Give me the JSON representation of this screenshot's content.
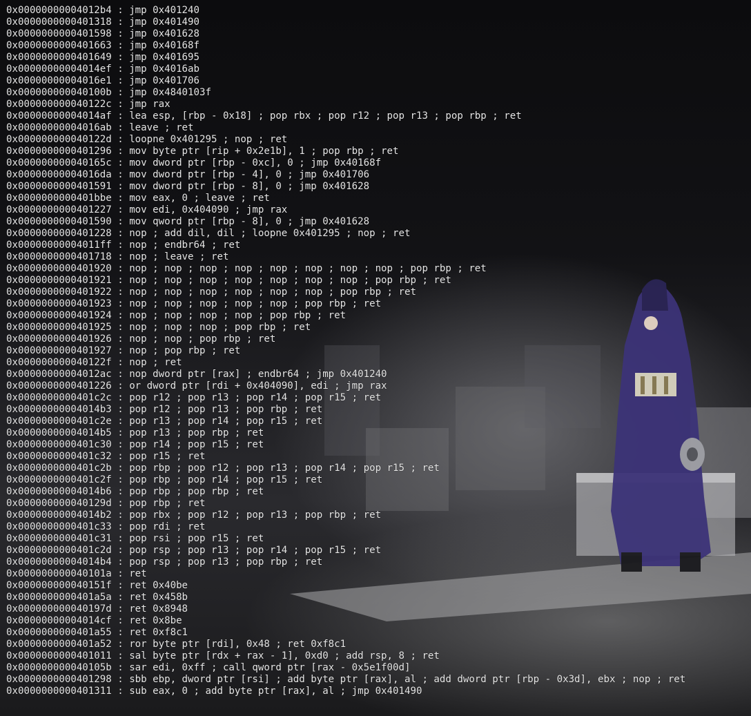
{
  "terminal": {
    "lines": [
      "0x00000000004012b4 : jmp 0x401240",
      "0x0000000000401318 : jmp 0x401490",
      "0x0000000000401598 : jmp 0x401628",
      "0x0000000000401663 : jmp 0x40168f",
      "0x0000000000401649 : jmp 0x401695",
      "0x00000000004014ef : jmp 0x4016ab",
      "0x00000000004016e1 : jmp 0x401706",
      "0x000000000040100b : jmp 0x4840103f",
      "0x000000000040122c : jmp rax",
      "0x00000000004014af : lea esp, [rbp - 0x18] ; pop rbx ; pop r12 ; pop r13 ; pop rbp ; ret",
      "0x00000000004016ab : leave ; ret",
      "0x000000000040122d : loopne 0x401295 ; nop ; ret",
      "0x0000000000401296 : mov byte ptr [rip + 0x2e1b], 1 ; pop rbp ; ret",
      "0x000000000040165c : mov dword ptr [rbp - 0xc], 0 ; jmp 0x40168f",
      "0x00000000004016da : mov dword ptr [rbp - 4], 0 ; jmp 0x401706",
      "0x0000000000401591 : mov dword ptr [rbp - 8], 0 ; jmp 0x401628",
      "0x0000000000401bbe : mov eax, 0 ; leave ; ret",
      "0x0000000000401227 : mov edi, 0x404090 ; jmp rax",
      "0x0000000000401590 : mov qword ptr [rbp - 8], 0 ; jmp 0x401628",
      "0x0000000000401228 : nop ; add dil, dil ; loopne 0x401295 ; nop ; ret",
      "0x00000000004011ff : nop ; endbr64 ; ret",
      "0x0000000000401718 : nop ; leave ; ret",
      "0x0000000000401920 : nop ; nop ; nop ; nop ; nop ; nop ; nop ; nop ; pop rbp ; ret",
      "0x0000000000401921 : nop ; nop ; nop ; nop ; nop ; nop ; nop ; pop rbp ; ret",
      "0x0000000000401922 : nop ; nop ; nop ; nop ; nop ; nop ; pop rbp ; ret",
      "0x0000000000401923 : nop ; nop ; nop ; nop ; nop ; pop rbp ; ret",
      "0x0000000000401924 : nop ; nop ; nop ; nop ; pop rbp ; ret",
      "0x0000000000401925 : nop ; nop ; nop ; pop rbp ; ret",
      "0x0000000000401926 : nop ; nop ; pop rbp ; ret",
      "0x0000000000401927 : nop ; pop rbp ; ret",
      "0x000000000040122f : nop ; ret",
      "0x00000000004012ac : nop dword ptr [rax] ; endbr64 ; jmp 0x401240",
      "0x0000000000401226 : or dword ptr [rdi + 0x404090], edi ; jmp rax",
      "0x0000000000401c2c : pop r12 ; pop r13 ; pop r14 ; pop r15 ; ret",
      "0x00000000004014b3 : pop r12 ; pop r13 ; pop rbp ; ret",
      "0x0000000000401c2e : pop r13 ; pop r14 ; pop r15 ; ret",
      "0x00000000004014b5 : pop r13 ; pop rbp ; ret",
      "0x0000000000401c30 : pop r14 ; pop r15 ; ret",
      "0x0000000000401c32 : pop r15 ; ret",
      "0x0000000000401c2b : pop rbp ; pop r12 ; pop r13 ; pop r14 ; pop r15 ; ret",
      "0x0000000000401c2f : pop rbp ; pop r14 ; pop r15 ; ret",
      "0x00000000004014b6 : pop rbp ; pop rbp ; ret",
      "0x000000000040129d : pop rbp ; ret",
      "0x00000000004014b2 : pop rbx ; pop r12 ; pop r13 ; pop rbp ; ret",
      "0x0000000000401c33 : pop rdi ; ret",
      "0x0000000000401c31 : pop rsi ; pop r15 ; ret",
      "0x0000000000401c2d : pop rsp ; pop r13 ; pop r14 ; pop r15 ; ret",
      "0x00000000004014b4 : pop rsp ; pop r13 ; pop rbp ; ret",
      "0x000000000040101a : ret",
      "0x000000000040151f : ret 0x40be",
      "0x0000000000401a5a : ret 0x458b",
      "0x000000000040197d : ret 0x8948",
      "0x00000000004014cf : ret 0x8be",
      "0x0000000000401a55 : ret 0xf8c1",
      "0x0000000000401a52 : ror byte ptr [rdi], 0x48 ; ret 0xf8c1",
      "0x0000000000401011 : sal byte ptr [rdx + rax - 1], 0xd0 ; add rsp, 8 ; ret",
      "0x000000000040105b : sar edi, 0xff ; call qword ptr [rax - 0x5e1f00d]",
      "0x0000000000401298 : sbb ebp, dword ptr [rsi] ; add byte ptr [rax], al ; add dword ptr [rbp - 0x3d], ebx ; nop ; ret",
      "0x0000000000401311 : sub eax, 0 ; add byte ptr [rax], al ; jmp 0x401490"
    ]
  }
}
